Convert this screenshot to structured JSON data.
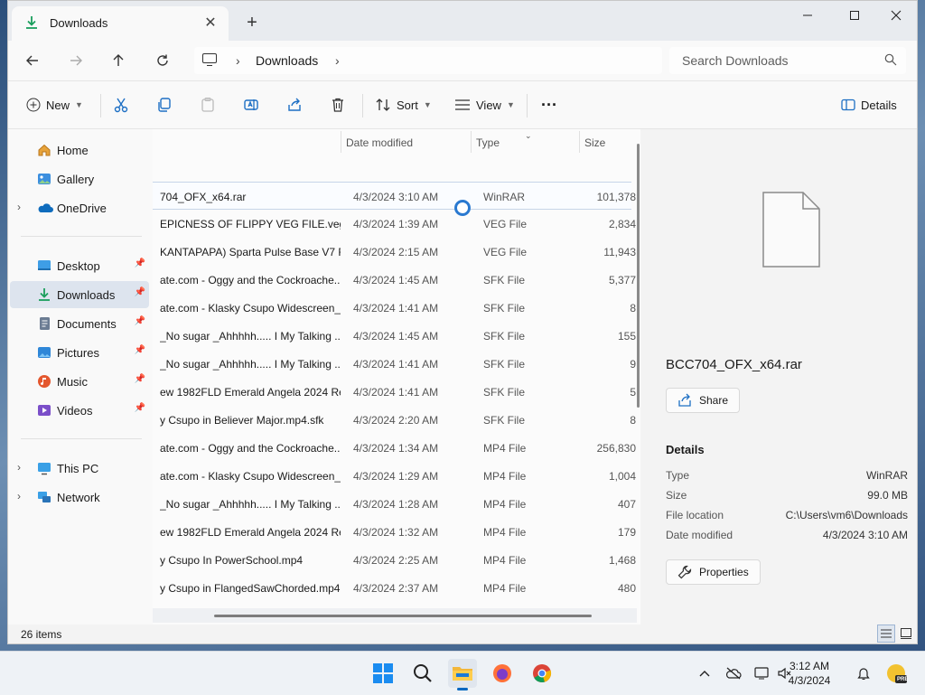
{
  "window": {
    "tab_title": "Downloads",
    "close_tab": "✕",
    "new_tab": "+"
  },
  "address": {
    "crumb": "Downloads",
    "search_placeholder": "Search Downloads"
  },
  "toolbar": {
    "new_label": "New",
    "sort_label": "Sort",
    "view_label": "View",
    "more_label": "···",
    "details_label": "Details"
  },
  "nav": {
    "items": [
      {
        "label": "Home",
        "icon": "home-icon"
      },
      {
        "label": "Gallery",
        "icon": "gallery-icon"
      },
      {
        "label": "OneDrive",
        "icon": "cloud-icon"
      },
      {
        "label": "Desktop",
        "icon": "desktop-icon"
      },
      {
        "label": "Downloads",
        "icon": "download-icon"
      },
      {
        "label": "Documents",
        "icon": "documents-icon"
      },
      {
        "label": "Pictures",
        "icon": "pictures-icon"
      },
      {
        "label": "Music",
        "icon": "music-icon"
      },
      {
        "label": "Videos",
        "icon": "videos-icon"
      },
      {
        "label": "This PC",
        "icon": "pc-icon"
      },
      {
        "label": "Network",
        "icon": "network-icon"
      }
    ]
  },
  "list": {
    "headers": {
      "date": "Date modified",
      "type": "Type",
      "size": "Size"
    },
    "rows": [
      {
        "name": "704_OFX_x64.rar",
        "date": "4/3/2024 3:10 AM",
        "type": "WinRAR",
        "size": "101,378"
      },
      {
        "name": "EPICNESS OF FLIPPY VEG FILE.veg",
        "date": "4/3/2024 1:39 AM",
        "type": "VEG File",
        "size": "2,834"
      },
      {
        "name": "KANTAPAPA) Sparta Pulse Base V7 R...",
        "date": "4/3/2024 2:15 AM",
        "type": "VEG File",
        "size": "11,943"
      },
      {
        "name": "ate.com - Oggy and the Cockroache...",
        "date": "4/3/2024 1:45 AM",
        "type": "SFK File",
        "size": "5,377"
      },
      {
        "name": "ate.com - Klasky Csupo Widescreen_...",
        "date": "4/3/2024 1:41 AM",
        "type": "SFK File",
        "size": "8"
      },
      {
        "name": "_No sugar _Ahhhhh..... I My Talking ...",
        "date": "4/3/2024 1:45 AM",
        "type": "SFK File",
        "size": "155"
      },
      {
        "name": "_No sugar _Ahhhhh..... I My Talking ...",
        "date": "4/3/2024 1:41 AM",
        "type": "SFK File",
        "size": "9"
      },
      {
        "name": "ew 1982FLD Emerald Angela 2024 Re...",
        "date": "4/3/2024 1:41 AM",
        "type": "SFK File",
        "size": "5"
      },
      {
        "name": "y Csupo in Believer Major.mp4.sfk",
        "date": "4/3/2024 2:20 AM",
        "type": "SFK File",
        "size": "8"
      },
      {
        "name": "ate.com - Oggy and the Cockroache...",
        "date": "4/3/2024 1:34 AM",
        "type": "MP4 File",
        "size": "256,830"
      },
      {
        "name": "ate.com - Klasky Csupo Widescreen_...",
        "date": "4/3/2024 1:29 AM",
        "type": "MP4 File",
        "size": "1,004"
      },
      {
        "name": "_No sugar _Ahhhhh..... I My Talking ...",
        "date": "4/3/2024 1:28 AM",
        "type": "MP4 File",
        "size": "407"
      },
      {
        "name": "ew 1982FLD Emerald Angela 2024 Re...",
        "date": "4/3/2024 1:32 AM",
        "type": "MP4 File",
        "size": "179"
      },
      {
        "name": "y Csupo In PowerSchool.mp4",
        "date": "4/3/2024 2:25 AM",
        "type": "MP4 File",
        "size": "1,468"
      },
      {
        "name": "y Csupo in FlangedSawChorded.mp4",
        "date": "4/3/2024 2:37 AM",
        "type": "MP4 File",
        "size": "480"
      }
    ]
  },
  "details": {
    "file_name": "BCC704_OFX_x64.rar",
    "share_label": "Share",
    "heading": "Details",
    "props": [
      {
        "key": "Type",
        "value": "WinRAR"
      },
      {
        "key": "Size",
        "value": "99.0 MB"
      },
      {
        "key": "File location",
        "value": "C:\\Users\\vm6\\Downloads"
      },
      {
        "key": "Date modified",
        "value": "4/3/2024 3:10 AM"
      }
    ],
    "properties_label": "Properties"
  },
  "status": {
    "count": "26 items"
  },
  "taskbar": {
    "time": "3:12 AM",
    "date": "4/3/2024",
    "badge": "PRE"
  },
  "colors": {
    "accent": "#0067c0",
    "selection": "#dde4ee"
  }
}
